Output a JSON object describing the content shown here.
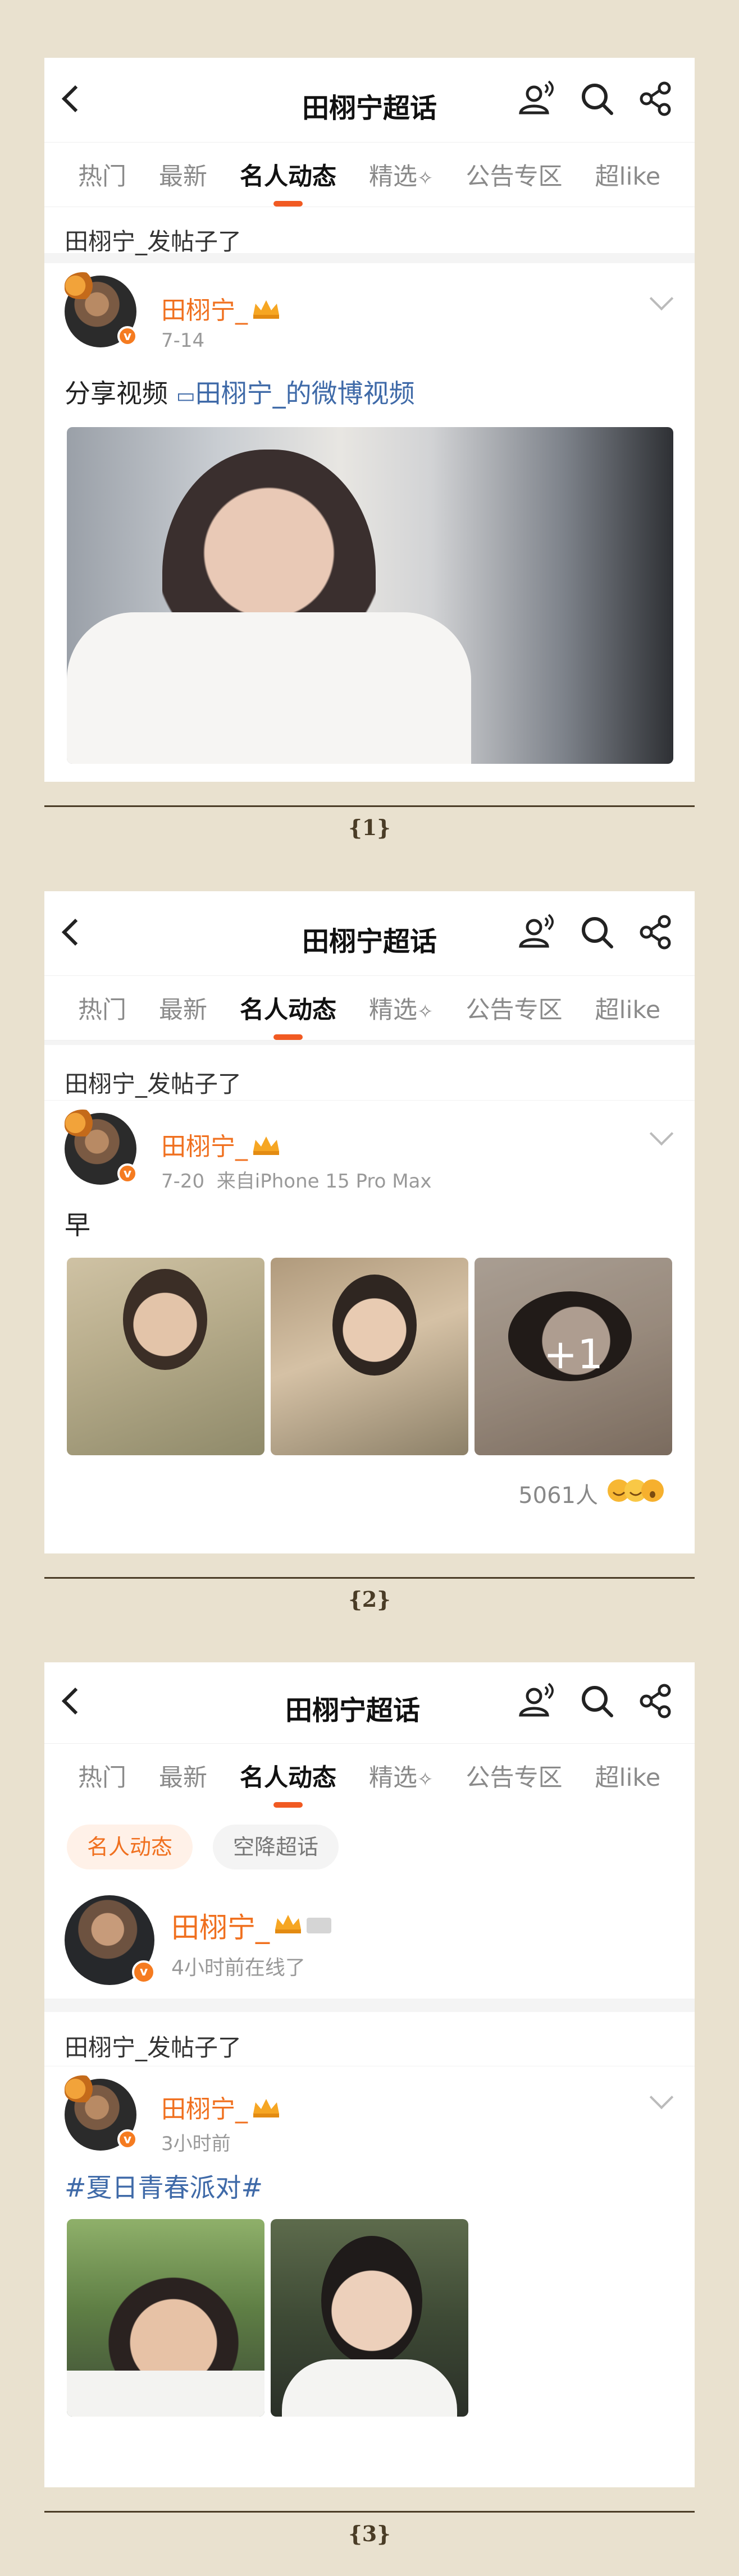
{
  "header": {
    "title": "田栩宁超话",
    "icons": [
      "profile-wave-icon",
      "search-icon",
      "share-icon"
    ]
  },
  "tabs": [
    {
      "label": "热门"
    },
    {
      "label": "最新"
    },
    {
      "label": "名人动态",
      "active": true
    },
    {
      "label": "精选"
    },
    {
      "label": "公告专区"
    },
    {
      "label": "超like"
    }
  ],
  "section_title": "田栩宁_发帖子了",
  "screens": [
    {
      "caption": "{1}",
      "post": {
        "author": "田栩宁_",
        "time": "7-14",
        "text_prefix": "分享视频",
        "video_link": "田栩宁_的微博视频"
      }
    },
    {
      "caption": "{2}",
      "post": {
        "author": "田栩宁_",
        "time": "7-20",
        "source": "来自iPhone 15 Pro Max",
        "text": "早",
        "more_images": "+1",
        "likes": "5061人"
      }
    },
    {
      "caption": "{3}",
      "filters": [
        "名人动态",
        "空降超话"
      ],
      "profile": {
        "name": "田栩宁_",
        "status": "4小时前在线了"
      },
      "post": {
        "author": "田栩宁_",
        "time": "3小时前",
        "hashtag": "#夏日青春派对#"
      }
    }
  ],
  "colors": {
    "accent": "#f15a22",
    "username": "#f0701f",
    "link": "#3f6aa8",
    "background": "#e9e1cf",
    "separator": "#4a3c26"
  }
}
